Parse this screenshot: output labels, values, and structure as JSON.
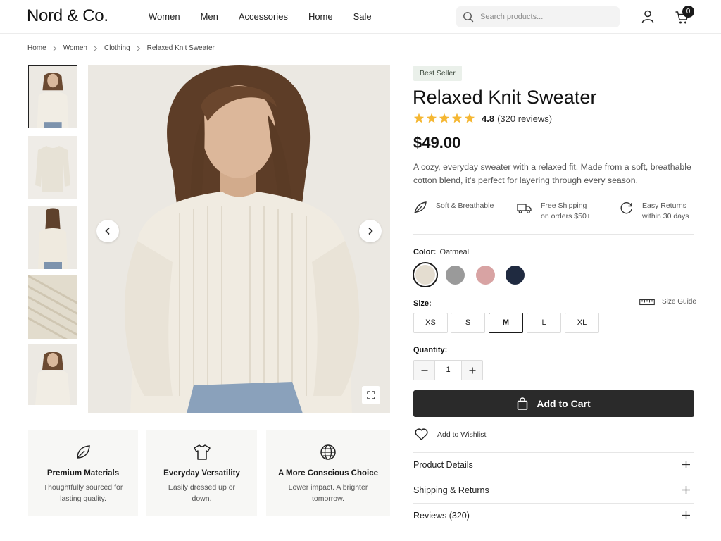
{
  "header": {
    "logo": "Nord & Co.",
    "nav": [
      "Women",
      "Men",
      "Accessories",
      "Home",
      "Sale"
    ],
    "search_placeholder": "Search products...",
    "cart_count": "0"
  },
  "breadcrumb": [
    "Home",
    "Women",
    "Clothing",
    "Relaxed Knit Sweater"
  ],
  "gallery": {
    "thumbnails": [
      "model-front",
      "sweater-flat",
      "model-back",
      "knit-texture",
      "model-hands"
    ],
    "active_index": 0
  },
  "features": [
    {
      "icon": "leaf-icon",
      "title": "Premium Materials",
      "desc": "Thoughtfully sourced for lasting quality."
    },
    {
      "icon": "tshirt-icon",
      "title": "Everyday Versatility",
      "desc": "Easily dressed up or down."
    },
    {
      "icon": "globe-icon",
      "title": "A More Conscious Choice",
      "desc": "Lower impact. A brighter tomorrow."
    }
  ],
  "product": {
    "badge": "Best Seller",
    "title": "Relaxed Knit Sweater",
    "rating": "4.8",
    "rating_stars": 5,
    "reviews": "(320 reviews)",
    "price": "$49.00",
    "description": "A cozy, everyday sweater with a relaxed fit. Made from a soft, breathable cotton blend, it’s perfect for layering through every season."
  },
  "perks": [
    {
      "icon": "feather-icon",
      "line1": "Soft & Breathable",
      "line2": ""
    },
    {
      "icon": "truck-icon",
      "line1": "Free Shipping",
      "line2": "on orders $50+"
    },
    {
      "icon": "return-icon",
      "line1": "Easy Returns",
      "line2": "within 30 days"
    }
  ],
  "color": {
    "label": "Color:",
    "selected": "Oatmeal",
    "swatches": [
      {
        "name": "Oatmeal",
        "hex": "#e4ddd0"
      },
      {
        "name": "Grey",
        "hex": "#9a9a9a"
      },
      {
        "name": "Rose",
        "hex": "#d8a3a3"
      },
      {
        "name": "Navy",
        "hex": "#1f2a40"
      }
    ]
  },
  "size": {
    "label": "Size:",
    "guide": "Size Guide",
    "options": [
      "XS",
      "S",
      "M",
      "L",
      "XL"
    ],
    "selected": "M"
  },
  "quantity": {
    "label": "Quantity:",
    "value": "1"
  },
  "actions": {
    "add_to_cart": "Add to Cart",
    "wishlist": "Add to Wishlist"
  },
  "accordions": [
    "Product Details",
    "Shipping & Returns",
    "Reviews (320)"
  ]
}
